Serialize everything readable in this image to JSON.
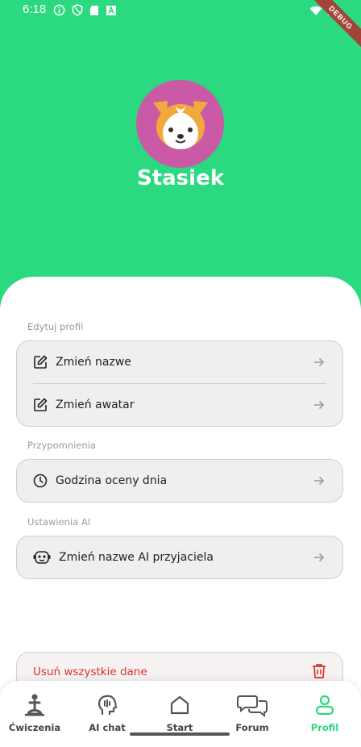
{
  "status_bar": {
    "time": "6:18"
  },
  "debug_banner": "DEBUG",
  "profile": {
    "name": "Stasiek"
  },
  "sections": [
    {
      "label": "Edytuj profil",
      "items": [
        {
          "label": "Zmień nazwe",
          "icon": "edit-icon"
        },
        {
          "label": "Zmień awatar",
          "icon": "edit-icon"
        }
      ]
    },
    {
      "label": "Przypomnienia",
      "items": [
        {
          "label": "Godzina oceny dnia",
          "icon": "clock-icon"
        }
      ]
    },
    {
      "label": "Ustawienia AI",
      "items": [
        {
          "label": "Zmień nazwe AI przyjaciela",
          "icon": "robot-icon"
        }
      ]
    }
  ],
  "danger": {
    "label": "Usuń wszystkie dane",
    "icon": "trash-icon"
  },
  "nav": [
    {
      "label": "Ćwiczenia",
      "icon": "exercise-icon"
    },
    {
      "label": "AI chat",
      "icon": "ai-head-icon"
    },
    {
      "label": "Start",
      "icon": "home-icon"
    },
    {
      "label": "Forum",
      "icon": "chat-bubbles-icon"
    },
    {
      "label": "Profil",
      "icon": "person-icon",
      "active": true
    }
  ],
  "colors": {
    "accent": "#2bd980",
    "avatar_bg": "#cb5aa6",
    "danger": "#d9322b"
  }
}
